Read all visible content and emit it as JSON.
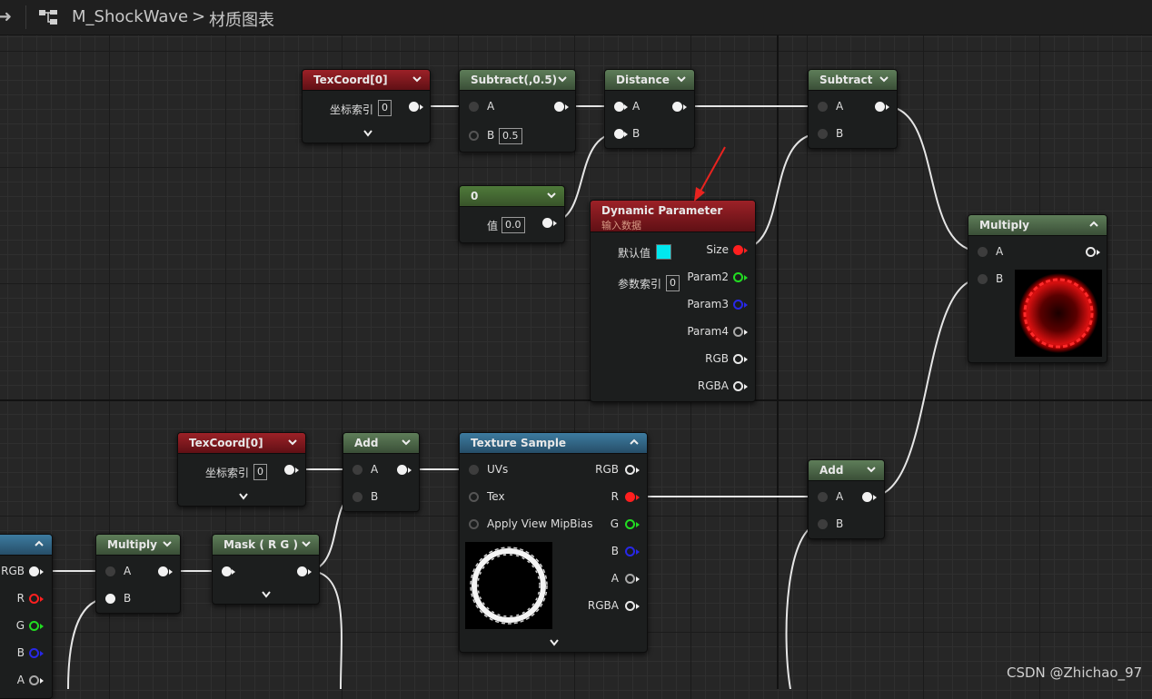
{
  "toolbar": {
    "back_icon": "arrow-right-icon",
    "graph_icon": "node-graph-icon",
    "asset_name": "M_ShockWave",
    "separator": ">",
    "graph_name": "材质图表"
  },
  "nodes": {
    "texcoord_top": {
      "title": "TexCoord[0]",
      "index_label": "坐标索引",
      "index_value": "0"
    },
    "subtract_half": {
      "title": "Subtract(,0.5)",
      "pin_a": "A",
      "pin_b": "B",
      "b_value": "0.5"
    },
    "distance": {
      "title": "Distance",
      "pin_a": "A",
      "pin_b": "B"
    },
    "subtract": {
      "title": "Subtract",
      "pin_a": "A",
      "pin_b": "B"
    },
    "constant": {
      "title": "0",
      "value_label": "值",
      "value": "0.0"
    },
    "dynamic_param": {
      "title": "Dynamic Parameter",
      "subtitle": "输入数据",
      "default_label": "默认值",
      "index_label": "参数索引",
      "index_value": "0",
      "outputs": [
        "Size",
        "Param2",
        "Param3",
        "Param4",
        "RGB",
        "RGBA"
      ]
    },
    "multiply_right": {
      "title": "Multiply",
      "pin_a": "A",
      "pin_b": "B"
    },
    "texcoord_bottom": {
      "title": "TexCoord[0]",
      "index_label": "坐标索引",
      "index_value": "0"
    },
    "add_left": {
      "title": "Add",
      "pin_a": "A",
      "pin_b": "B"
    },
    "texture_sample": {
      "title": "Texture Sample",
      "inputs": [
        "UVs",
        "Tex",
        "Apply View MipBias"
      ],
      "outputs": [
        "RGB",
        "R",
        "G",
        "B",
        "A",
        "RGBA"
      ]
    },
    "add_right": {
      "title": "Add",
      "pin_a": "A",
      "pin_b": "B"
    },
    "partial_node": {
      "outputs": [
        "RGB",
        "R",
        "G",
        "B",
        "A"
      ]
    },
    "multiply_left": {
      "title": "Multiply",
      "pin_a": "A",
      "pin_b": "B"
    },
    "mask": {
      "title": "Mask ( R G )"
    }
  },
  "colors": {
    "header_red": "#9c2127",
    "header_green": "#5e7d59",
    "header_blue": "#3d7ba0",
    "wire": "#e8e8e8",
    "default_value_swatch": "#00e8ee"
  },
  "watermark": "CSDN @Zhichao_97"
}
